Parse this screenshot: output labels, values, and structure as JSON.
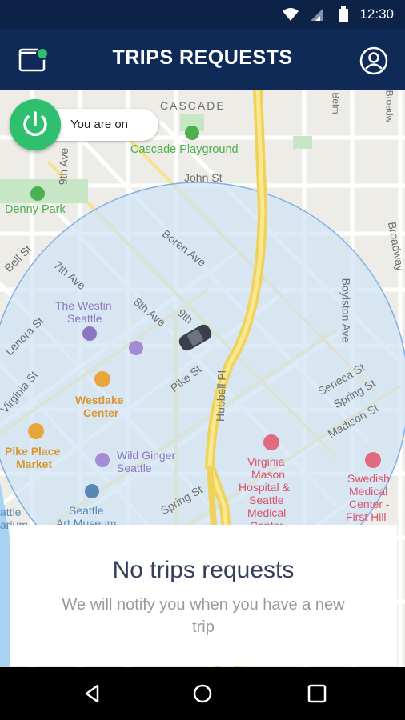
{
  "status_bar": {
    "time": "12:30"
  },
  "header": {
    "title": "TRIPS REQUESTS"
  },
  "toggle": {
    "label": "You are on"
  },
  "map": {
    "labels": {
      "cascade": "CASCADE",
      "cascade_playground": "Cascade Playground",
      "john_st": "John St",
      "denny_park": "Denny Park",
      "ninth_ave_north": "9th Ave",
      "boren_ave": "Boren Ave",
      "broadway": "Broadway",
      "bell_st": "Bell St",
      "seventh_ave": "7th Ave",
      "westin_1": "The Westin",
      "westin_2": "Seattle",
      "eighth_ave": "8th Ave",
      "ninth": "9th",
      "boylston_ave": "Boylston Ave",
      "lenora_st": "Lenora St",
      "virginia_st": "Virginia St",
      "pike_st": "Pike St",
      "hubbell_pl": "Hubbell Pl",
      "seneca_st": "Seneca St",
      "spring_st_right": "Spring St",
      "madison_st": "Madison St",
      "westlake_1": "Westlake",
      "westlake_2": "Center",
      "pike_place_1": "Pike Place",
      "pike_place_2": "Market",
      "wild_ginger_1": "Wild Ginger",
      "wild_ginger_2": "Seattle",
      "virginia_mason_1": "Virginia",
      "virginia_mason_2": "Mason",
      "virginia_mason_3": "Hospital &",
      "virginia_mason_4": "Seattle",
      "virginia_mason_5": "Medical",
      "virginia_mason_6": "Center",
      "swedish_1": "Swedish",
      "swedish_2": "Medical",
      "swedish_3": "Center -",
      "swedish_4": "First Hill",
      "seattle_art_1": "Seattle",
      "seattle_art_2": "Art Museum",
      "spring_st": "Spring St",
      "aquarium_1": "attle",
      "aquarium_2": "arium",
      "belmont": "Belm",
      "broadway_top": "Broadw"
    }
  },
  "empty_state": {
    "title": "No trips requests",
    "message": "We will notify you when you have a new trip"
  },
  "colors": {
    "app_bar": "#0f2a57",
    "status_bar": "#0c2247",
    "accent_green": "#2ebf6f",
    "radius_fill": "#cfe3f4",
    "radius_stroke": "#7fb0e8"
  }
}
